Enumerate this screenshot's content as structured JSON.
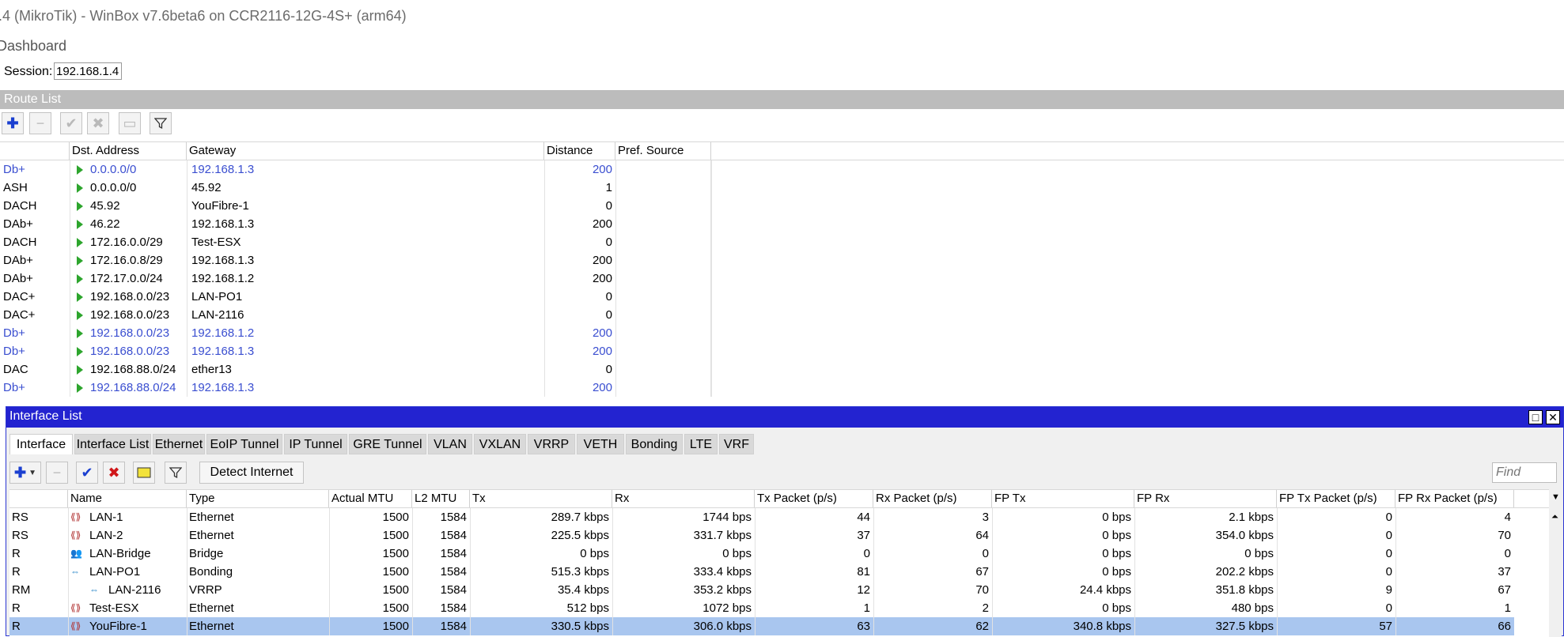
{
  "window": {
    "title": ".4 (MikroTik) - WinBox v7.6beta6 on CCR2116-12G-4S+ (arm64)"
  },
  "menu": {
    "dashboard": "Dashboard"
  },
  "session": {
    "label": "Session:",
    "value": "192.168.1.4"
  },
  "route_list": {
    "title": "Route List",
    "toolbar": {
      "add": "add-icon",
      "remove": "minus-icon",
      "enable": "check-icon",
      "disable": "x-icon",
      "comment": "comment-icon",
      "filter": "filter-icon"
    },
    "columns": [
      "",
      "Dst. Address",
      "Gateway",
      "Distance",
      "Pref. Source"
    ],
    "rows": [
      {
        "flags": "Db+",
        "dst": "0.0.0.0/0",
        "gateway": "192.168.1.3",
        "distance": "200",
        "blue": true
      },
      {
        "flags": "ASH",
        "dst": "0.0.0.0/0",
        "gateway": "45.92",
        "distance": "1",
        "blue": false
      },
      {
        "flags": "DACH",
        "dst": "45.92",
        "gateway": "YouFibre-1",
        "distance": "0",
        "blue": false
      },
      {
        "flags": "DAb+",
        "dst": "46.22",
        "gateway": "192.168.1.3",
        "distance": "200",
        "blue": false
      },
      {
        "flags": "DACH",
        "dst": "172.16.0.0/29",
        "gateway": "Test-ESX",
        "distance": "0",
        "blue": false
      },
      {
        "flags": "DAb+",
        "dst": "172.16.0.8/29",
        "gateway": "192.168.1.3",
        "distance": "200",
        "blue": false
      },
      {
        "flags": "DAb+",
        "dst": "172.17.0.0/24",
        "gateway": "192.168.1.2",
        "distance": "200",
        "blue": false
      },
      {
        "flags": "DAC+",
        "dst": "192.168.0.0/23",
        "gateway": "LAN-PO1",
        "distance": "0",
        "blue": false
      },
      {
        "flags": "DAC+",
        "dst": "192.168.0.0/23",
        "gateway": "LAN-2116",
        "distance": "0",
        "blue": false
      },
      {
        "flags": "Db+",
        "dst": "192.168.0.0/23",
        "gateway": "192.168.1.2",
        "distance": "200",
        "blue": true
      },
      {
        "flags": "Db+",
        "dst": "192.168.0.0/23",
        "gateway": "192.168.1.3",
        "distance": "200",
        "blue": true
      },
      {
        "flags": "DAC",
        "dst": "192.168.88.0/24",
        "gateway": "ether13",
        "distance": "0",
        "blue": false
      },
      {
        "flags": "Db+",
        "dst": "192.168.88.0/24",
        "gateway": "192.168.1.3",
        "distance": "200",
        "blue": true
      }
    ]
  },
  "interface_list": {
    "title": "Interface List",
    "tabs": [
      "Interface",
      "Interface List",
      "Ethernet",
      "EoIP Tunnel",
      "IP Tunnel",
      "GRE Tunnel",
      "VLAN",
      "VXLAN",
      "VRRP",
      "VETH",
      "Bonding",
      "LTE",
      "VRF"
    ],
    "active_tab": "Interface",
    "detect_internet": "Detect Internet",
    "find_placeholder": "Find",
    "columns": [
      "",
      "Name",
      "Type",
      "Actual MTU",
      "L2 MTU",
      "Tx",
      "Rx",
      "Tx Packet (p/s)",
      "Rx Packet (p/s)",
      "FP Tx",
      "FP Rx",
      "FP Tx Packet (p/s)",
      "FP Rx Packet (p/s)"
    ],
    "rows": [
      {
        "flags": "RS",
        "name": "LAN-1",
        "icon": "ethernet-icon",
        "type": "Ethernet",
        "mtu": "1500",
        "l2mtu": "1584",
        "tx": "289.7 kbps",
        "rx": "1744 bps",
        "txp": "44",
        "rxp": "3",
        "fptx": "0 bps",
        "fprx": "2.1 kbps",
        "fptxp": "0",
        "fprxp": "4"
      },
      {
        "flags": "RS",
        "name": "LAN-2",
        "icon": "ethernet-icon",
        "type": "Ethernet",
        "mtu": "1500",
        "l2mtu": "1584",
        "tx": "225.5 kbps",
        "rx": "331.7 kbps",
        "txp": "37",
        "rxp": "64",
        "fptx": "0 bps",
        "fprx": "354.0 kbps",
        "fptxp": "0",
        "fprxp": "70"
      },
      {
        "flags": "R",
        "name": "LAN-Bridge",
        "icon": "bridge-icon",
        "type": "Bridge",
        "mtu": "1500",
        "l2mtu": "1584",
        "tx": "0 bps",
        "rx": "0 bps",
        "txp": "0",
        "rxp": "0",
        "fptx": "0 bps",
        "fprx": "0 bps",
        "fptxp": "0",
        "fprxp": "0"
      },
      {
        "flags": "R",
        "name": "LAN-PO1",
        "icon": "bonding-icon",
        "type": "Bonding",
        "mtu": "1500",
        "l2mtu": "1584",
        "tx": "515.3 kbps",
        "rx": "333.4 kbps",
        "txp": "81",
        "rxp": "67",
        "fptx": "0 bps",
        "fprx": "202.2 kbps",
        "fptxp": "0",
        "fprxp": "37"
      },
      {
        "flags": "RM",
        "name": "LAN-2116",
        "icon": "vrrp-icon",
        "type": "VRRP",
        "mtu": "1500",
        "l2mtu": "1584",
        "tx": "35.4 kbps",
        "rx": "353.2 kbps",
        "txp": "12",
        "rxp": "70",
        "fptx": "24.4 kbps",
        "fprx": "351.8 kbps",
        "fptxp": "9",
        "fprxp": "67",
        "indent": true
      },
      {
        "flags": "R",
        "name": "Test-ESX",
        "icon": "ethernet-icon",
        "type": "Ethernet",
        "mtu": "1500",
        "l2mtu": "1584",
        "tx": "512 bps",
        "rx": "1072 bps",
        "txp": "1",
        "rxp": "2",
        "fptx": "0 bps",
        "fprx": "480 bps",
        "fptxp": "0",
        "fprxp": "1"
      },
      {
        "flags": "R",
        "name": "YouFibre-1",
        "icon": "ethernet-icon",
        "type": "Ethernet",
        "mtu": "1500",
        "l2mtu": "1584",
        "tx": "330.5 kbps",
        "rx": "306.0 kbps",
        "txp": "63",
        "rxp": "62",
        "fptx": "340.8 kbps",
        "fprx": "327.5 kbps",
        "fptxp": "57",
        "fprxp": "66",
        "selected": true
      }
    ]
  }
}
